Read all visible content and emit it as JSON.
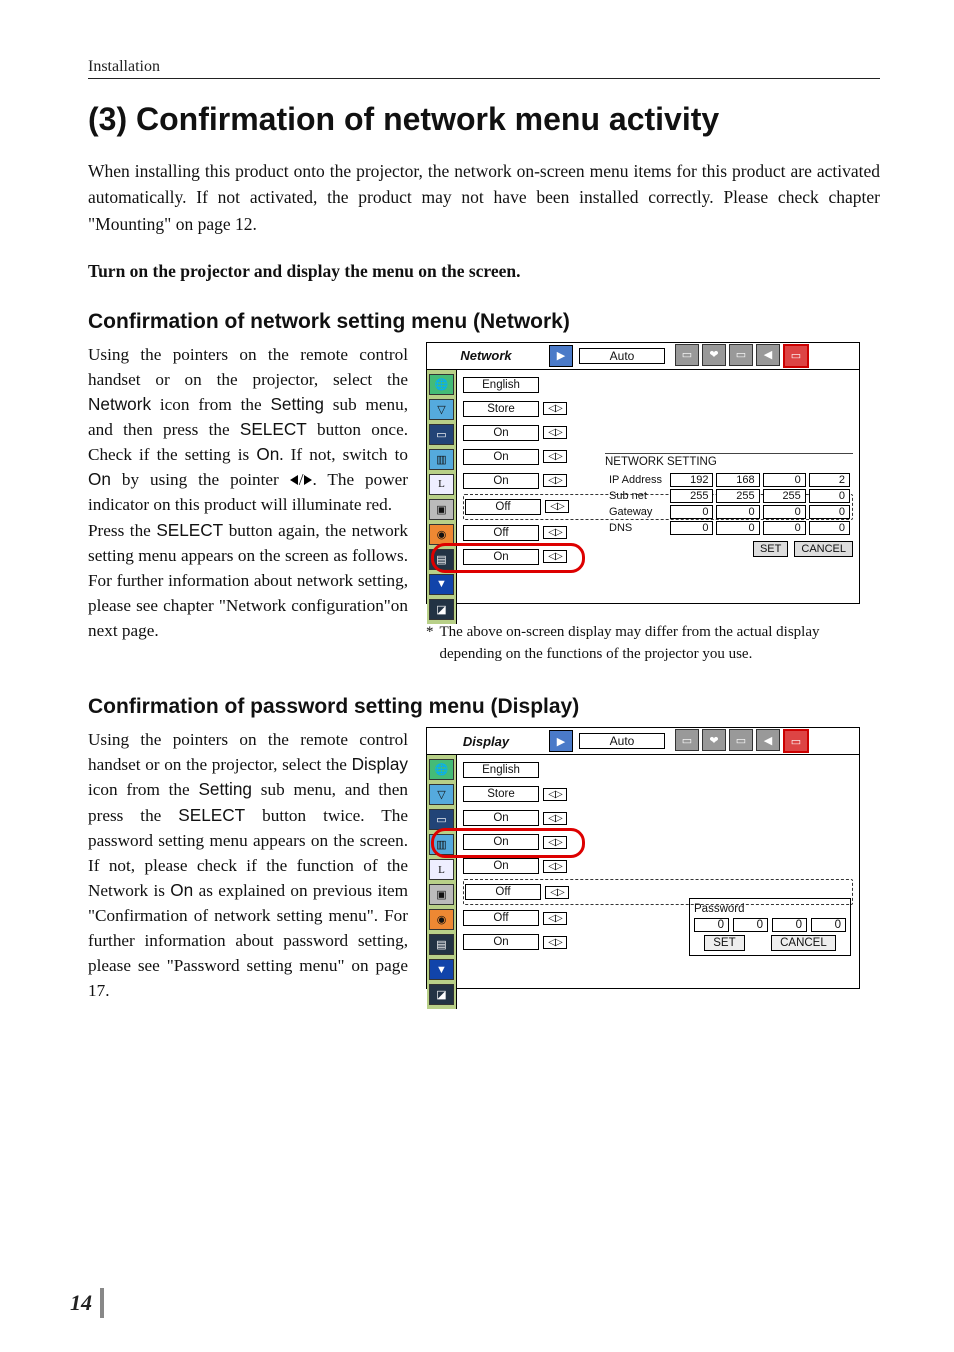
{
  "meta": {
    "section": "Installation",
    "page_number": "14"
  },
  "h1": "(3) Confirmation of network menu activity",
  "intro": "When installing this product onto the projector, the network on-screen menu items for this product are activated automatically. If not activated, the product may not have been installed correctly. Please check chapter \"Mounting\" on page 12.",
  "bold_line": "Turn on the projector and display the menu on the screen.",
  "network": {
    "heading": "Confirmation of network setting menu (Network)",
    "para1_a": "Using the pointers on the remote control handset or on the projector, select the ",
    "kw_network": "Network",
    "para1_b": " icon from the ",
    "kw_setting": "Setting",
    "para1_c": " sub menu, and then press the ",
    "kw_select": "SELECT",
    "para1_d": " button once. Check if the setting is ",
    "kw_on": "On",
    "para1_e": ". If not, switch to ",
    "kw_on2": "On",
    "para1_f": " by using the pointer ",
    "para1_g": ". The power indicator on this product will illuminate red.",
    "para2_a": "Press the ",
    "kw_select2": "SELECT",
    "para2_b": " button again, the network setting menu appears on the screen as follows. For further information about network setting, please see chapter \"Network configuration\"on next page.",
    "osd": {
      "title": "Network",
      "auto": "Auto",
      "rows": [
        "English",
        "Store",
        "On",
        "On",
        "On",
        "Off",
        "Off",
        "On"
      ],
      "panel": {
        "title": "NETWORK SETTING",
        "labels": [
          "IP Address",
          "Sub net",
          "Gateway",
          "DNS"
        ],
        "cells": [
          [
            "192",
            "168",
            "0",
            "2"
          ],
          [
            "255",
            "255",
            "255",
            "0"
          ],
          [
            "0",
            "0",
            "0",
            "0"
          ],
          [
            "0",
            "0",
            "0",
            "0"
          ]
        ],
        "set": "SET",
        "cancel": "CANCEL"
      }
    },
    "note": "The above on-screen display may differ from the actual display depending on the functions of the projector you use."
  },
  "display": {
    "heading": "Confirmation of password setting menu (Display)",
    "para_a": "Using the pointers on the remote control handset or on the projector, select the ",
    "kw_display": "Display",
    "para_b": " icon from the ",
    "kw_setting": "Setting",
    "para_c": " sub menu, and then press the ",
    "kw_select": "SELECT",
    "para_d": " button twice. The password setting menu appears on the screen. If not, please check if the function of the Network is ",
    "kw_on": "On",
    "para_e": " as explained on previous item \"Confirmation of network setting menu\". For further information about password setting, please see \"Password setting menu\" on page 17.",
    "osd": {
      "title": "Display",
      "auto": "Auto",
      "rows": [
        "English",
        "Store",
        "On",
        "On",
        "On",
        "Off",
        "Off",
        "On"
      ],
      "panel": {
        "title": "Password",
        "cells": [
          "0",
          "0",
          "0",
          "0"
        ],
        "set": "SET",
        "cancel": "CANCEL"
      }
    }
  },
  "icons": {
    "globe": "🌐",
    "tri": "▽",
    "rect": "▭",
    "disp": "▥",
    "l": "L",
    "plug": "▣",
    "sound": "◉",
    "net": "▤",
    "down": "▼",
    "exit": "◪",
    "arrows": "◁▷",
    "star": "*"
  }
}
